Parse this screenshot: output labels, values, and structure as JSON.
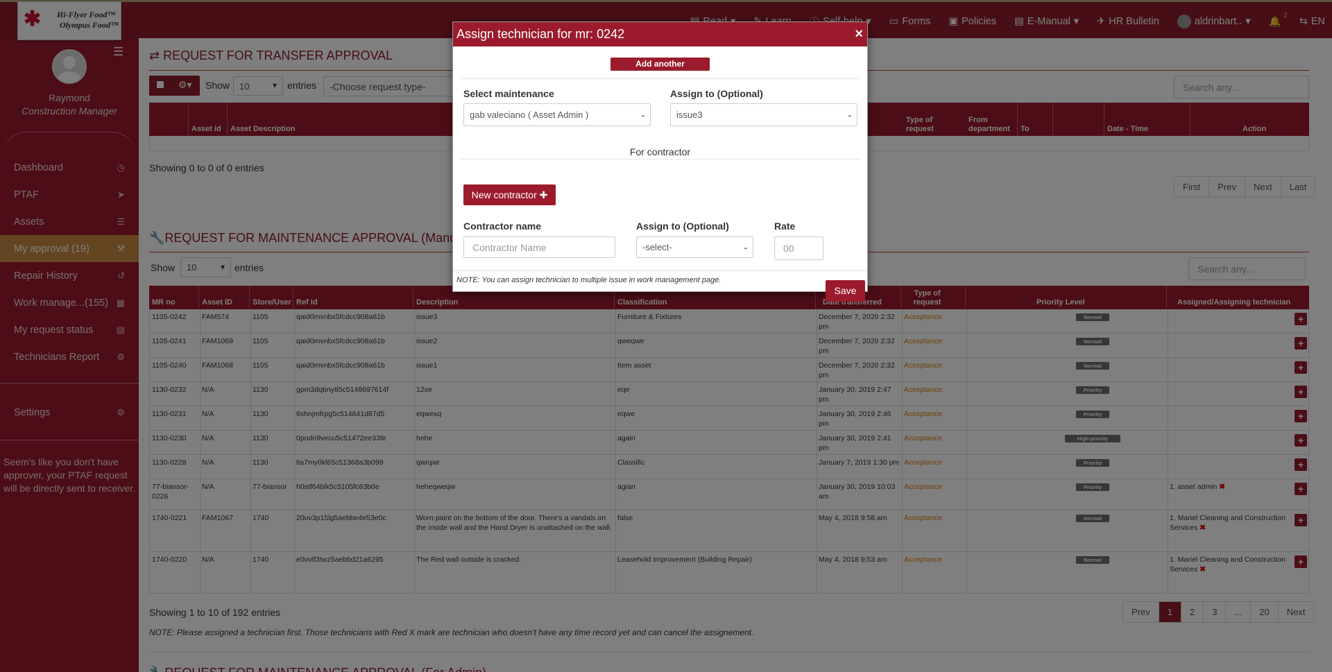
{
  "brand": {
    "line1": "Hi-Flyer Food™",
    "line2": "Olympus Food™"
  },
  "topnav": {
    "read": "Read",
    "learn": "Learn",
    "selfhelp": "Self-help",
    "forms": "Forms",
    "policies": "Policies",
    "emanual": "E-Manual",
    "hr": "HR Bulletin",
    "user": "aldrinbart..",
    "notif_count": "2",
    "lang": "EN"
  },
  "sidebar": {
    "name": "Raymond",
    "role": "Construction Manager",
    "items": [
      {
        "label": "Dashboard",
        "icon": "dashboard-icon"
      },
      {
        "label": "PTAF",
        "icon": "paper-plane-icon"
      },
      {
        "label": "Assets",
        "icon": "list-icon"
      },
      {
        "label": "My approval (19)",
        "icon": "gavel-icon"
      },
      {
        "label": "Repair History",
        "icon": "history-icon"
      },
      {
        "label": "Work manage...(155)",
        "icon": "calendar-icon"
      },
      {
        "label": "My request status",
        "icon": "file-icon"
      },
      {
        "label": "Technicians Report",
        "icon": "users-cog-icon"
      }
    ],
    "settings": "Settings",
    "note": "Seem's like you don't have approver, your PTAF request will be directly sent to receiver."
  },
  "transfer": {
    "title": "REQUEST FOR TRANSFER APPROVAL",
    "show": "Show",
    "entries_value": "10",
    "entries": "entries",
    "request_type": "-Choose request type-",
    "search_placeholder": "Search any...",
    "columns": [
      "Asset id",
      "Asset Description",
      "Type of request",
      "From department",
      "To",
      "Date - Time",
      "Action"
    ],
    "info": "Showing 0 to 0 of 0 entries",
    "pager": [
      "First",
      "Prev",
      "Next",
      "Last"
    ]
  },
  "maintenance": {
    "title": "REQUEST FOR MAINTENANCE APPROVAL (Manu",
    "show": "Show",
    "entries_value": "10",
    "entries": "entries",
    "search_placeholder": "Search any...",
    "columns": [
      "MR no",
      "Asset ID",
      "Store/User",
      "Ref Id",
      "Description",
      "Classification",
      "Date transferred",
      "Type of request",
      "Priority Level",
      "Assigned/Assigning technician"
    ],
    "rows": [
      {
        "mr": "1105-0242",
        "asset": "FAM574",
        "store": "1105",
        "ref": "qaid0mvnbx5fcdcc908a61b",
        "desc": "issue3",
        "cls": "Furniture & Fixtures",
        "date": "December 7, 2020 2:32 pm",
        "type": "Acceptance",
        "priority": "Normal",
        "tech": ""
      },
      {
        "mr": "1105-0241",
        "asset": "FAM1069",
        "store": "1105",
        "ref": "qaid0mvnbx5fcdcc908a61b",
        "desc": "issue2",
        "cls": "qweqwe",
        "date": "December 7, 2020 2:32 pm",
        "type": "Acceptance",
        "priority": "Normal",
        "tech": ""
      },
      {
        "mr": "1105-0240",
        "asset": "FAM1068",
        "store": "1105",
        "ref": "qaid0mvnbx5fcdcc908a61b",
        "desc": "issue1",
        "cls": "Item asset",
        "date": "December 7, 2020 2:32 pm",
        "type": "Acceptance",
        "priority": "Normal",
        "tech": ""
      },
      {
        "mr": "1130-0232",
        "asset": "N/A",
        "store": "1130",
        "ref": "gpm3dqbny85c5148697614f",
        "desc": "12xe",
        "cls": "eqe",
        "date": "January 30, 2019 2:47 pm",
        "type": "Acceptance",
        "priority": "Priority",
        "tech": ""
      },
      {
        "mr": "1130-0231",
        "asset": "N/A",
        "store": "1130",
        "ref": "6shnjmfrpg5c514841d87d5",
        "desc": "eqwexq",
        "cls": "eqwe",
        "date": "January 30, 2019 2:46 pm",
        "type": "Acceptance",
        "priority": "Priority",
        "tech": ""
      },
      {
        "mr": "1130-0230",
        "asset": "N/A",
        "store": "1130",
        "ref": "0podn9vecu5c51472ee33fe",
        "desc": "hehe",
        "cls": "again",
        "date": "January 30, 2019 2:41 pm",
        "type": "Acceptance",
        "priority": "High priority",
        "tech": ""
      },
      {
        "mr": "1130-0228",
        "asset": "N/A",
        "store": "1130",
        "ref": "tia7my0kl65c51368a3b099",
        "desc": "qwrqwr",
        "cls": "Classific",
        "date": "January 7, 2019 1:30 pm",
        "type": "Acceptance",
        "priority": "Priority",
        "tech": ""
      },
      {
        "mr": "77-biansor-0226",
        "asset": "N/A",
        "store": "77-biansor",
        "ref": "h0stf64blk5c5105fc83b0e",
        "desc": "heheqweqw",
        "cls": "agian",
        "date": "January 30, 2019 10:03 am",
        "type": "Acceptance",
        "priority": "Priority",
        "tech": "1. asset admin"
      },
      {
        "mr": "1740-0221",
        "asset": "FAM1067",
        "store": "1740",
        "ref": "20uv3p15lg5aebbe4e53e0c",
        "desc": "Worn paint on the bottom of the door. There's a vandals on the inside wall and the Hand Dryer is unattached on the wall.",
        "cls": "false",
        "date": "May 4, 2018 9:58 am",
        "type": "Acceptance",
        "priority": "Normal",
        "tech": "1. Mariel Cleaning and Construction Services"
      },
      {
        "mr": "1740-0220",
        "asset": "N/A",
        "store": "1740",
        "ref": "e0ovlf3twz5aebbd21a6295",
        "desc": "The Red wall outside is cracked.",
        "cls": "Leasehold Improvement (Building Repair)",
        "date": "May 4, 2018 9:53 am",
        "type": "Acceptance",
        "priority": "Normal",
        "tech": "1. Mariel Cleaning and Construction Services"
      }
    ],
    "info": "Showing 1 to 10 of 192 entries",
    "pager": [
      "Prev",
      "1",
      "2",
      "3",
      "...",
      "20",
      "Next"
    ],
    "note": "NOTE: Please assigned a technician first. Those technicians with Red X mark are technician who doesn't have any time record yet and can cancel the assignement.",
    "next_title": "REQUEST FOR MAINTENANCE APPROVAL (For Admin)"
  },
  "modal": {
    "title": "Assign technician for mr: 0242",
    "add_tech": "Add another technician",
    "select_maint_label": "Select maintenance",
    "select_maint_value": "gab valeciano ( Asset Admin )",
    "assign_label": "Assign to (Optional)",
    "assign_value": "issue3",
    "for_contractor": "For contractor",
    "new_contractor": "New contractor",
    "contractor_name_label": "Contractor name",
    "contractor_name_placeholder": "Contractor Name",
    "assign2_label": "Assign to (Optional)",
    "assign2_value": "-select-",
    "rate_label": "Rate",
    "rate_placeholder": "00",
    "note": "NOTE: You can assign technician to multiple issue in work management page.",
    "save": "Save"
  },
  "colors": {
    "primary": "#9b1b2d",
    "accent": "#c98a42",
    "acceptance": "#e07b00"
  }
}
